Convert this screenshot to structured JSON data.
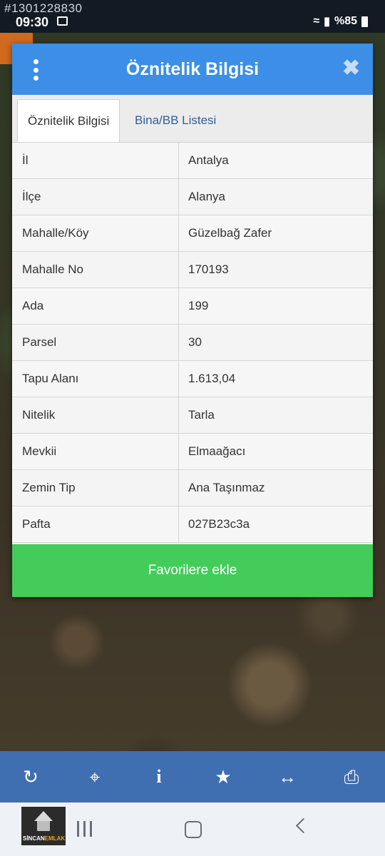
{
  "status_bar": {
    "watermark_id": "#1301228830",
    "time": "09:30",
    "signal_text": "%85"
  },
  "dialog": {
    "title": "Öznitelik Bilgisi",
    "tabs": [
      {
        "label": "Öznitelik Bilgisi",
        "active": true
      },
      {
        "label": "Bina/BB Listesi",
        "active": false
      }
    ],
    "rows": [
      {
        "key": "İl",
        "value": "Antalya"
      },
      {
        "key": "İlçe",
        "value": "Alanya"
      },
      {
        "key": "Mahalle/Köy",
        "value": "Güzelbağ Zafer"
      },
      {
        "key": "Mahalle No",
        "value": "170193"
      },
      {
        "key": "Ada",
        "value": "199"
      },
      {
        "key": "Parsel",
        "value": "30"
      },
      {
        "key": "Tapu Alanı",
        "value": "1.613,04"
      },
      {
        "key": "Nitelik",
        "value": "Tarla"
      },
      {
        "key": "Mevkii",
        "value": "Elmaağacı"
      },
      {
        "key": "Zemin Tip",
        "value": "Ana Taşınmaz"
      },
      {
        "key": "Pafta",
        "value": "027B23c3a"
      }
    ],
    "favorite_button": "Favorilere ekle"
  },
  "toolbar": {
    "icons": [
      "refresh-icon",
      "locate-icon",
      "info-icon",
      "star-icon",
      "measure-icon",
      "print-icon"
    ]
  },
  "logo": {
    "text_a": "SİNCAN",
    "text_b": "EMLAK"
  },
  "colors": {
    "header_blue": "#3c8ee6",
    "favorite_green": "#44cc5a",
    "toolbar_blue": "#3f6fb0"
  }
}
